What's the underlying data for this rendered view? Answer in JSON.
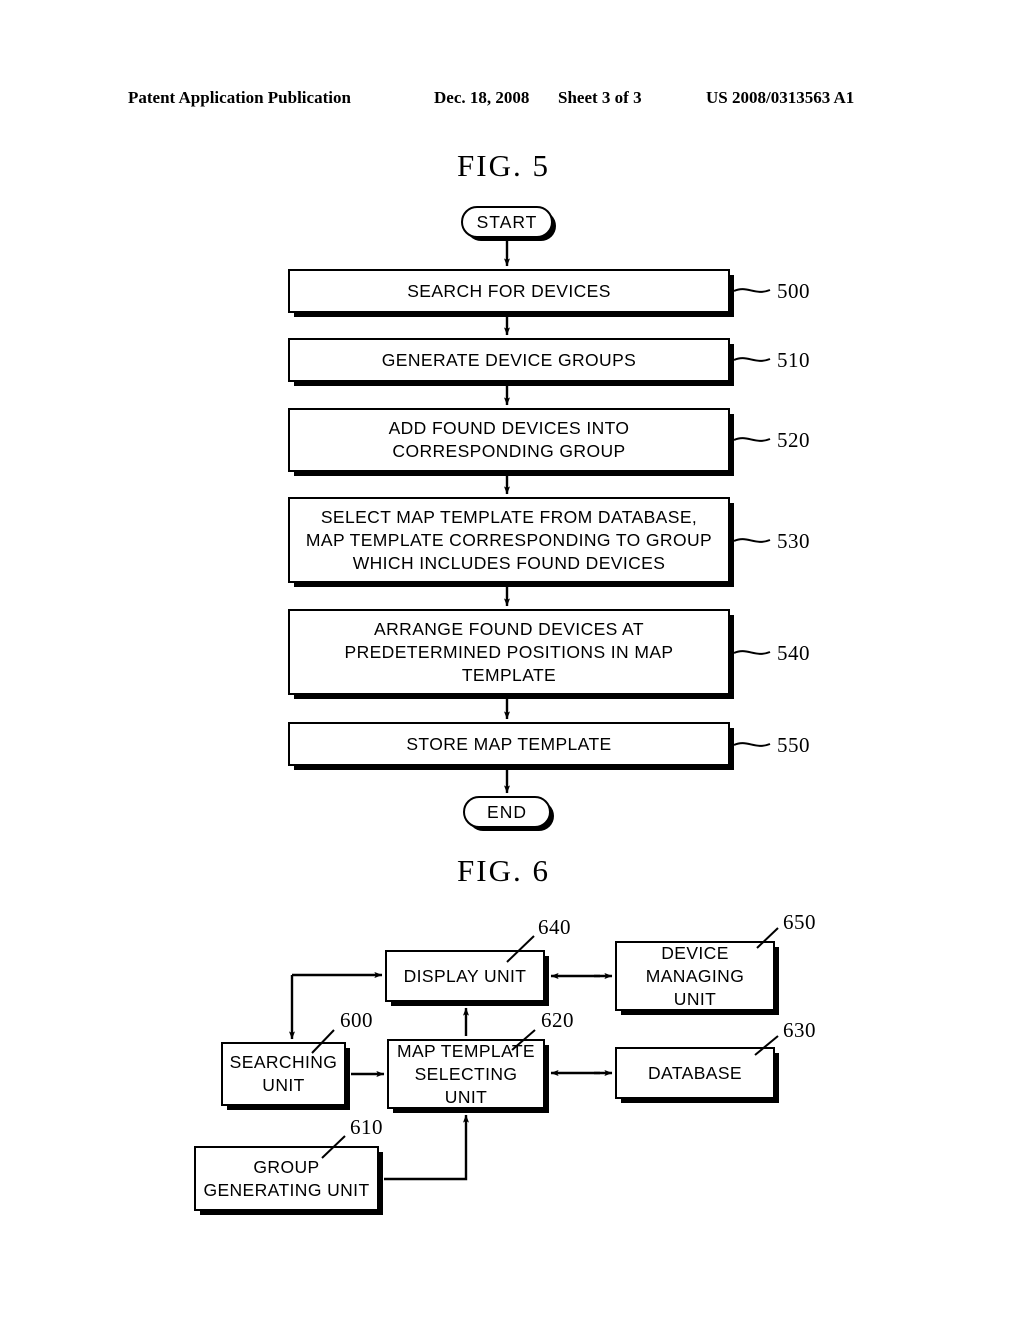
{
  "header": {
    "publication": "Patent Application Publication",
    "date": "Dec. 18, 2008",
    "sheet": "Sheet 3 of 3",
    "patent_number": "US 2008/0313563 A1"
  },
  "figures": [
    {
      "id": "fig5",
      "title": "FIG.  5",
      "type": "flowchart",
      "start_label": "START",
      "end_label": "END",
      "steps": [
        {
          "ref": "500",
          "text": "SEARCH FOR DEVICES"
        },
        {
          "ref": "510",
          "text": "GENERATE DEVICE GROUPS"
        },
        {
          "ref": "520",
          "text": "ADD FOUND DEVICES INTO\nCORRESPONDING GROUP"
        },
        {
          "ref": "530",
          "text": "SELECT MAP TEMPLATE FROM DATABASE,\nMAP TEMPLATE CORRESPONDING TO GROUP\nWHICH INCLUDES FOUND DEVICES"
        },
        {
          "ref": "540",
          "text": "ARRANGE FOUND DEVICES AT\nPREDETERMINED POSITIONS IN MAP\nTEMPLATE"
        },
        {
          "ref": "550",
          "text": "STORE MAP TEMPLATE"
        }
      ]
    },
    {
      "id": "fig6",
      "title": "FIG.  6",
      "type": "block-diagram",
      "blocks": [
        {
          "ref": "600",
          "text": "SEARCHING\nUNIT"
        },
        {
          "ref": "610",
          "text": "GROUP\nGENERATING UNIT"
        },
        {
          "ref": "620",
          "text": "MAP TEMPLATE\nSELECTING UNIT"
        },
        {
          "ref": "630",
          "text": "DATABASE"
        },
        {
          "ref": "640",
          "text": "DISPLAY UNIT"
        },
        {
          "ref": "650",
          "text": "DEVICE\nMANAGING UNIT"
        }
      ]
    }
  ],
  "colors": {
    "ink": "#000000",
    "paper": "#ffffff"
  }
}
